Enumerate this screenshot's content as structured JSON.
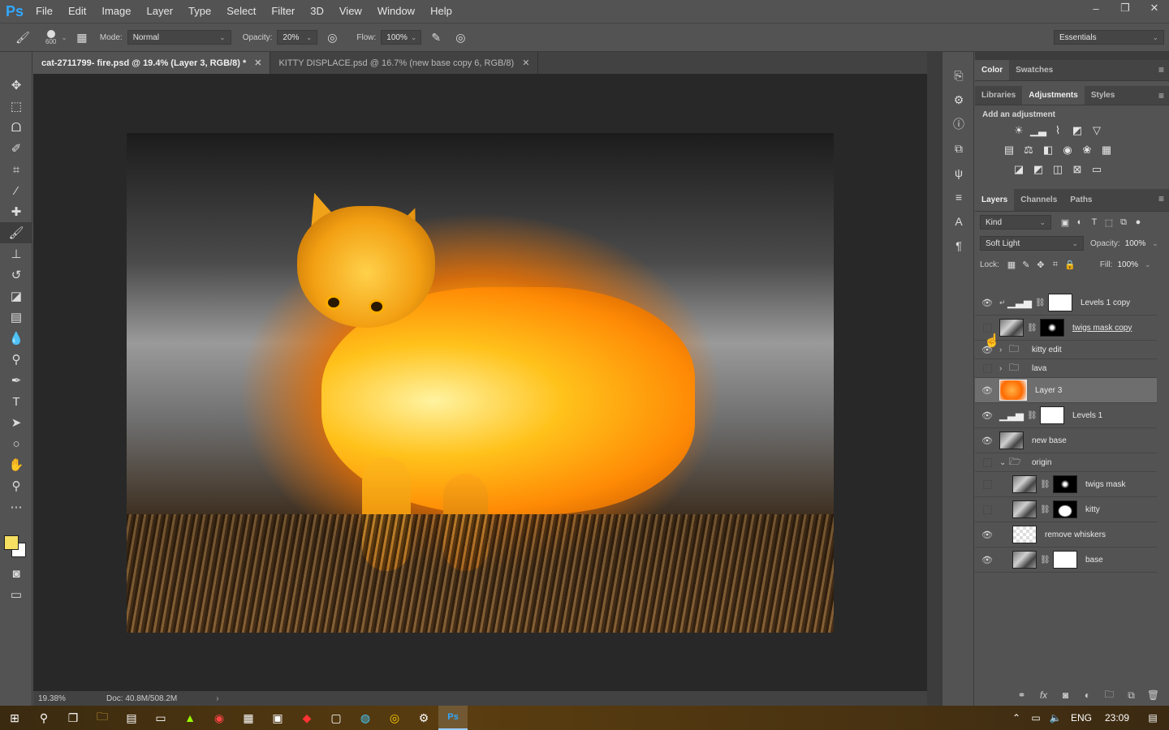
{
  "app": {
    "logo": "Ps",
    "window_controls": [
      "–",
      "❐",
      "✕"
    ]
  },
  "menu": [
    "File",
    "Edit",
    "Image",
    "Layer",
    "Type",
    "Select",
    "Filter",
    "3D",
    "View",
    "Window",
    "Help"
  ],
  "options": {
    "brush_size": "600",
    "mode_label": "Mode:",
    "mode_value": "Normal",
    "opacity_label": "Opacity:",
    "opacity_value": "20%",
    "flow_label": "Flow:",
    "flow_value": "100%",
    "workspace": "Essentials"
  },
  "tabs": [
    {
      "label": "cat-2711799- fire.psd @ 19.4% (Layer 3, RGB/8) *",
      "active": true
    },
    {
      "label": "KITTY DISPLACE.psd @ 16.7% (new base copy 6, RGB/8)",
      "active": false
    }
  ],
  "tools": [
    "move-tool",
    "marquee-tool",
    "lasso-tool",
    "quick-select-tool",
    "crop-tool",
    "eyedropper-tool",
    "healing-brush-tool",
    "brush-tool",
    "clone-stamp-tool",
    "history-brush-tool",
    "eraser-tool",
    "gradient-tool",
    "blur-tool",
    "dodge-tool",
    "pen-tool",
    "type-tool",
    "path-select-tool",
    "ellipse-tool",
    "hand-tool",
    "zoom-tool",
    "more-tools"
  ],
  "colors": {
    "foreground": "#f7e061",
    "background": "#ffffff"
  },
  "status": {
    "zoom": "19.38%",
    "doc": "Doc: 40.8M/508.2M"
  },
  "panels": {
    "color_tabs": [
      "Color",
      "Swatches"
    ],
    "adj_tabs": [
      "Libraries",
      "Adjustments",
      "Styles"
    ],
    "adj_title": "Add an adjustment",
    "layer_tabs": [
      "Layers",
      "Channels",
      "Paths"
    ],
    "kind_label": "Kind",
    "blend_mode": "Soft Light",
    "opacity_label": "Opacity:",
    "opacity_value": "100%",
    "lock_label": "Lock:",
    "fill_label": "Fill:",
    "fill_value": "100%"
  },
  "layers": [
    {
      "name": "Levels 1 copy",
      "visible": true,
      "thumb": "levels",
      "mask": "white",
      "clipped": true
    },
    {
      "name": "twigs mask copy",
      "visible": false,
      "thumb": "photo",
      "mask": "black"
    },
    {
      "name": "kitty edit",
      "visible": true,
      "type": "folder"
    },
    {
      "name": "lava",
      "visible": false,
      "type": "folder"
    },
    {
      "name": "Layer 3",
      "visible": true,
      "thumb": "fire",
      "selected": true
    },
    {
      "name": "Levels 1",
      "visible": true,
      "thumb": "levels",
      "mask": "white"
    },
    {
      "name": "new base",
      "visible": true,
      "thumb": "photo"
    },
    {
      "name": "origin",
      "visible": false,
      "type": "folder-open"
    },
    {
      "name": "twigs mask",
      "visible": false,
      "thumb": "photo",
      "mask": "black",
      "indent": true
    },
    {
      "name": "kitty",
      "visible": false,
      "thumb": "photo",
      "mask": "kitty",
      "indent": true
    },
    {
      "name": "remove whiskers",
      "visible": true,
      "thumb": "check",
      "indent": true
    },
    {
      "name": "base",
      "visible": true,
      "thumb": "photo",
      "mask": "white",
      "indent": true
    }
  ],
  "taskbar": {
    "lang": "ENG",
    "time": "23:09"
  }
}
